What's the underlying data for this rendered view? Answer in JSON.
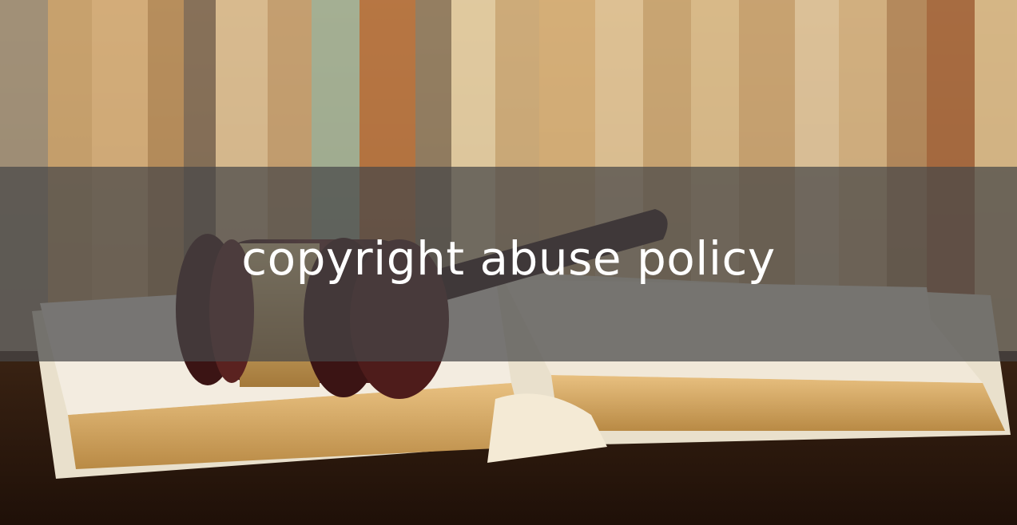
{
  "hero": {
    "title": "copyright abuse policy",
    "background_image": "gavel-on-open-book-with-bookshelf"
  },
  "colors": {
    "overlay": "#464648",
    "title_text": "#ffffff",
    "book_pages": "#d9a85a",
    "gavel": "#4a1c1c",
    "table": "#2b170c"
  }
}
